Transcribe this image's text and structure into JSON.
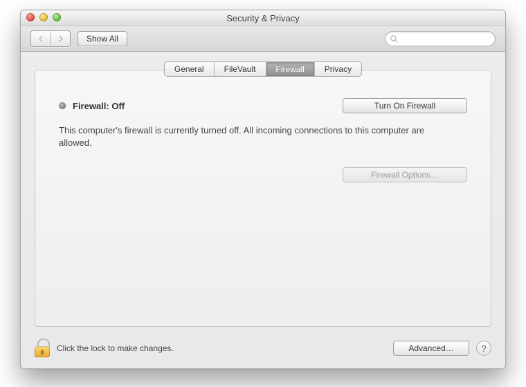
{
  "window": {
    "title": "Security & Privacy"
  },
  "toolbar": {
    "show_all_label": "Show All",
    "search_value": "",
    "search_placeholder": ""
  },
  "tabs": [
    {
      "label": "General",
      "active": false
    },
    {
      "label": "FileVault",
      "active": false
    },
    {
      "label": "Firewall",
      "active": true
    },
    {
      "label": "Privacy",
      "active": false
    }
  ],
  "firewall": {
    "status_label": "Firewall: Off",
    "status_color": "#8a8a8a",
    "turn_on_label": "Turn On Firewall",
    "description": "This computer's firewall is currently turned off. All incoming connections to this computer are allowed.",
    "options_label": "Firewall Options…",
    "options_enabled": false
  },
  "footer": {
    "lock_hint": "Click the lock to make changes.",
    "advanced_label": "Advanced…",
    "help_label": "?"
  }
}
